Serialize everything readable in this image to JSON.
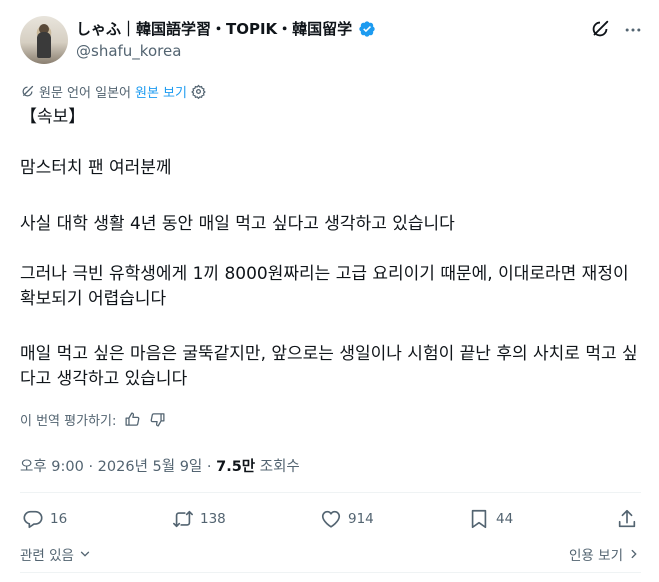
{
  "author": {
    "display_name": "しゃふ｜韓国語学習・TOPIK・韓国留学",
    "handle": "@shafu_korea"
  },
  "translation": {
    "original_lang_label": "원문 언어 일본어",
    "view_original_link": "원본 보기"
  },
  "tweet": {
    "line1": "【속보】",
    "line2": "맘스터치 팬 여러분께",
    "line3": "사실 대학 생활 4년 동안 매일 먹고 싶다고 생각하고 있습니다",
    "line4": "그러나 극빈 유학생에게 1끼 8000원짜리는 고급 요리이기 때문에, 이대로라면 재정이 확보되기 어렵습니다",
    "line5": "매일 먹고 싶은 마음은 굴뚝같지만, 앞으로는 생일이나 시험이 끝난 후의 사치로 먹고 싶다고 생각하고 있습니다"
  },
  "rate_translation_label": "이 번역 평가하기:",
  "meta": {
    "time": "오후 9:00 · 2026년 5월 9일 · ",
    "views_count": "7.5만",
    "views_label": " 조회수"
  },
  "actions": {
    "replies": "16",
    "reposts": "138",
    "likes": "914",
    "bookmarks": "44"
  },
  "footer": {
    "related_label": "관련 있음",
    "quotes_label": "인용 보기"
  },
  "colors": {
    "accent": "#1d9bf0",
    "text": "#0f1419",
    "muted": "#536471",
    "divider": "#eff3f4"
  },
  "icons": [
    "verified-badge-icon",
    "grok-icon",
    "more-icon",
    "translate-icon",
    "gear-icon",
    "thumbs-up-icon",
    "thumbs-down-icon",
    "reply-icon",
    "repost-icon",
    "like-icon",
    "bookmark-icon",
    "share-icon",
    "chevron-down-icon",
    "chevron-right-icon"
  ]
}
